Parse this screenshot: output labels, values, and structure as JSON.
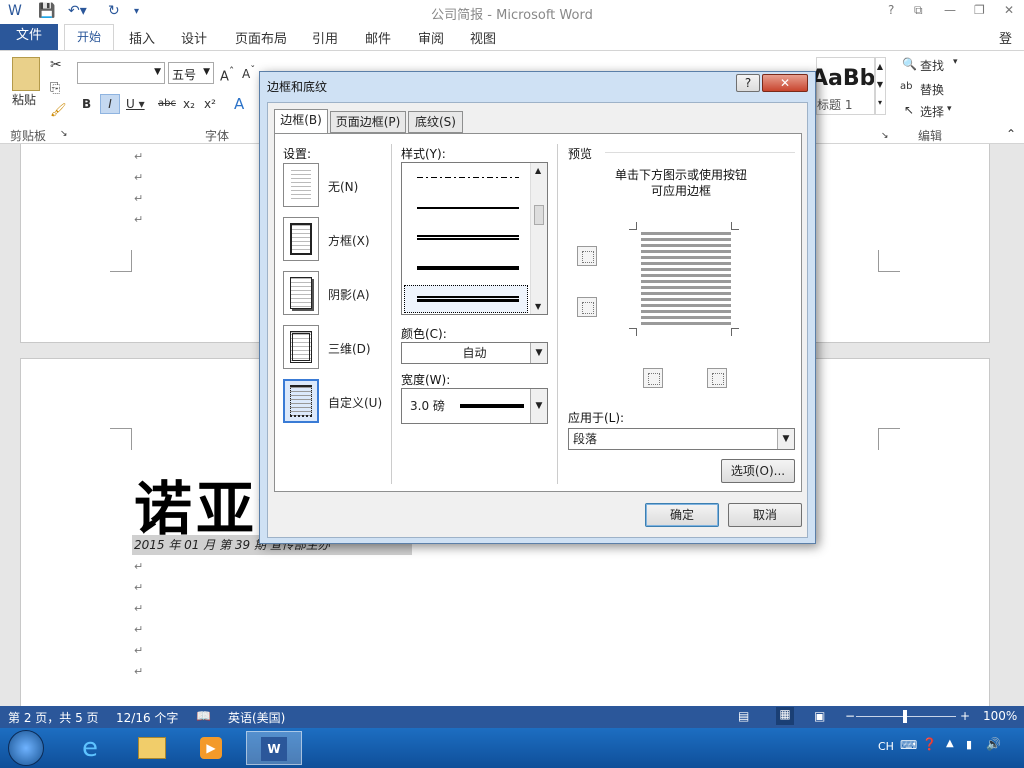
{
  "window": {
    "title": "公司简报 - Microsoft Word",
    "help": "?",
    "login": "登录"
  },
  "tabs": [
    "文件",
    "开始",
    "插入",
    "设计",
    "页面布局",
    "引用",
    "邮件",
    "审阅",
    "视图"
  ],
  "ribbon": {
    "paste_label": "粘贴",
    "font_size": "五号",
    "groups": {
      "clipboard": "剪贴板",
      "font": "字体",
      "edit": "编辑"
    },
    "style_preview": "AaBb",
    "style_name": "标题 1",
    "find": "查找",
    "replace": "替换",
    "select": "选择"
  },
  "document": {
    "heading": "诺亚涉",
    "subline": "2015 年 01 月      第 39 期      宣传部主办",
    "para_mark": "↵"
  },
  "dialog": {
    "title": "边框和底纹",
    "tabs": [
      "边框(B)",
      "页面边框(P)",
      "底纹(S)"
    ],
    "settings_label": "设置:",
    "settings": [
      "无(N)",
      "方框(X)",
      "阴影(A)",
      "三维(D)",
      "自定义(U)"
    ],
    "style_label": "样式(Y):",
    "color_label": "颜色(C):",
    "color_value": "自动",
    "width_label": "宽度(W):",
    "width_value": "3.0 磅",
    "preview_label": "预览",
    "preview_hint": "单击下方图示或使用按钮可应用边框",
    "apply_label": "应用于(L):",
    "apply_value": "段落",
    "options_button": "选项(O)...",
    "ok_button": "确定",
    "cancel_button": "取消",
    "close": "✕"
  },
  "status": {
    "page": "第 2 页，共 5 页",
    "words": "12/16 个字",
    "language": "英语(美国)",
    "zoom": "100%"
  },
  "taskbar": {
    "ime": "CH"
  }
}
